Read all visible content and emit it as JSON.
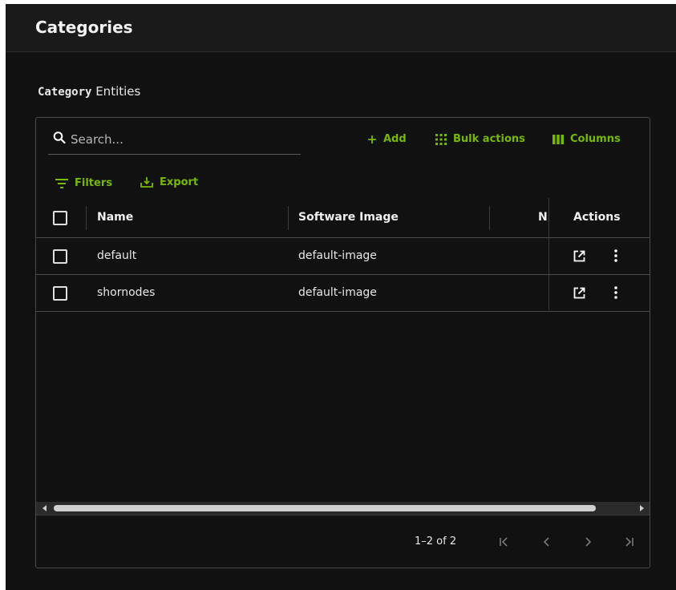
{
  "header": {
    "title": "Categories"
  },
  "section": {
    "title_bold": "Category",
    "title_rest": " Entities"
  },
  "toolbar": {
    "search_placeholder": "Search...",
    "add_label": "Add",
    "bulk_actions_label": "Bulk actions",
    "columns_label": "Columns",
    "filters_label": "Filters",
    "export_label": "Export"
  },
  "table": {
    "columns": [
      "Name",
      "Software Image",
      "N",
      "Actions"
    ],
    "rows": [
      {
        "name": "default",
        "software_image": "default-image"
      },
      {
        "name": "shornodes",
        "software_image": "default-image"
      }
    ]
  },
  "pagination": {
    "range_text": "1–2 of 2"
  },
  "colors": {
    "accent": "#76b900",
    "background": "#111111",
    "header": "#1a1a1a"
  },
  "icons": [
    "search-icon",
    "plus-icon",
    "grid-icon",
    "columns-icon",
    "filter-icon",
    "export-icon",
    "open-external-icon",
    "more-vert-icon",
    "first-page-icon",
    "prev-page-icon",
    "next-page-icon",
    "last-page-icon"
  ]
}
